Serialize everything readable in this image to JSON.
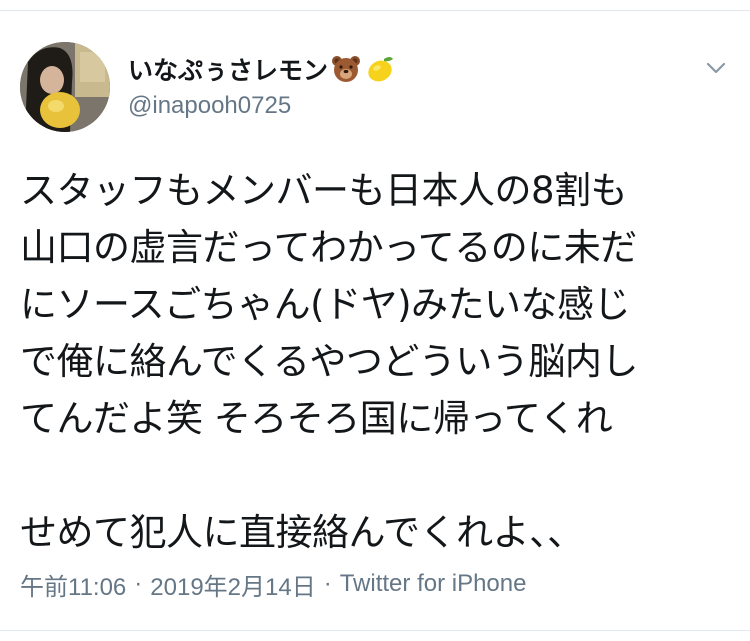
{
  "tweet": {
    "author": {
      "display_name": "いなぷぅさレモン",
      "emojis": [
        "bear-face",
        "lemon"
      ],
      "handle": "@inapooh0725"
    },
    "text": "スタッフもメンバーも日本人の8割も\n山口の虚言だってわかってるのに未だ\nにソースごちゃん(ドヤ)みたいな感じ\nで俺に絡んでくるやつどういう脳内し\nてんだよ笑 そろそろ国に帰ってくれ\n\nせめて犯人に直接絡んでくれよ、、",
    "time": "午前11:06",
    "separator": "·",
    "date": "2019年2月14日",
    "source": "Twitter for iPhone"
  },
  "icons": {
    "more": "chevron-down-icon",
    "avatar": "profile-photo"
  },
  "colors": {
    "text": "#14171a",
    "secondary": "#657786",
    "divider": "#e1e8ed"
  }
}
